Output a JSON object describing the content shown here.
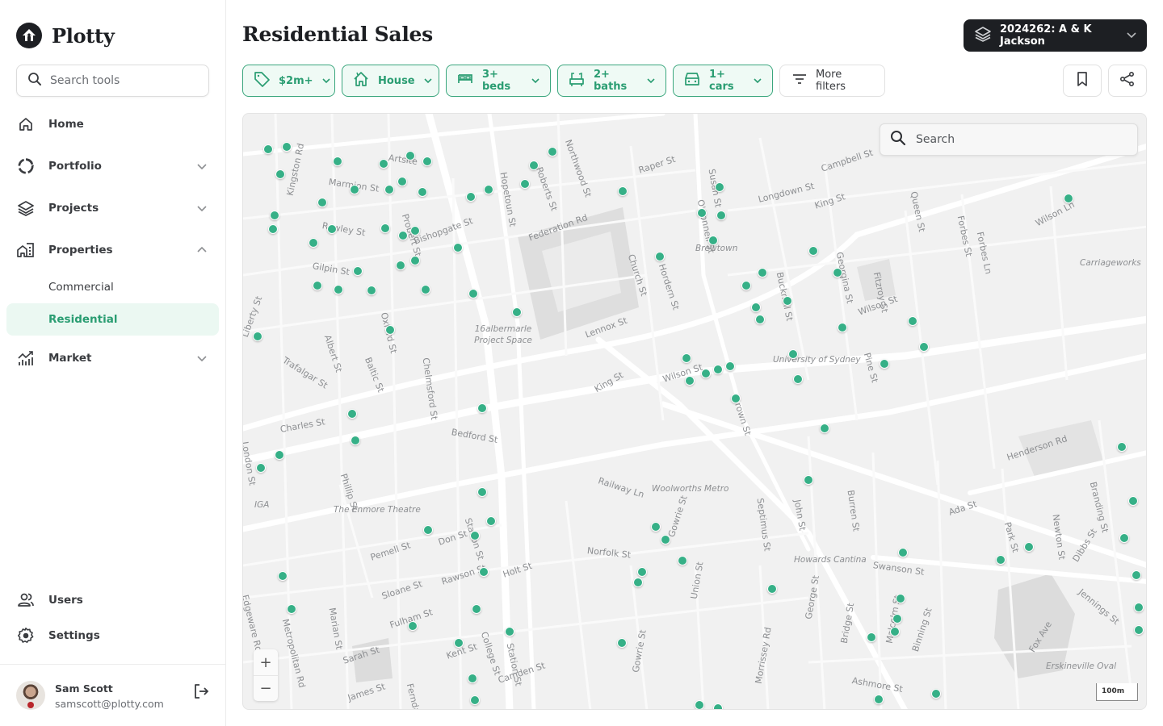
{
  "brand": {
    "name": "Plotty",
    "logo_icon": "home-up-arrow-icon"
  },
  "sidebar": {
    "search_placeholder": "Search tools",
    "items": [
      {
        "label": "Home",
        "icon": "home-icon",
        "has_chevron": false
      },
      {
        "label": "Portfolio",
        "icon": "portfolio-ring-icon",
        "has_chevron": true,
        "expanded": false
      },
      {
        "label": "Projects",
        "icon": "layers-icon",
        "has_chevron": true,
        "expanded": false
      },
      {
        "label": "Properties",
        "icon": "buildings-icon",
        "has_chevron": true,
        "expanded": true,
        "children": [
          {
            "label": "Commercial",
            "active": false
          },
          {
            "label": "Residential",
            "active": true
          }
        ]
      },
      {
        "label": "Market",
        "icon": "market-chart-icon",
        "has_chevron": true,
        "expanded": false
      }
    ],
    "bottom_items": [
      {
        "label": "Users",
        "icon": "users-icon"
      },
      {
        "label": "Settings",
        "icon": "gear-icon"
      }
    ],
    "user": {
      "name": "Sam Scott",
      "email": "samscott@plotty.com",
      "logout_icon": "logout-icon"
    }
  },
  "header": {
    "title": "Residential Sales",
    "project_selector": {
      "label": "2024262: A & K Jackson",
      "icon": "layers-icon"
    },
    "filters": [
      {
        "label": "$2m+",
        "icon": "price-tag-icon",
        "active": true
      },
      {
        "label": "House",
        "icon": "house-icon",
        "active": true
      },
      {
        "label": "3+ beds",
        "icon": "bed-icon",
        "active": true
      },
      {
        "label": "2+ baths",
        "icon": "bath-icon",
        "active": true
      },
      {
        "label": "1+ cars",
        "icon": "car-icon",
        "active": true
      },
      {
        "label": "More filters",
        "icon": "filter-lines-icon",
        "active": false
      }
    ],
    "actions": [
      {
        "name": "bookmark",
        "icon": "bookmark-icon"
      },
      {
        "name": "share",
        "icon": "share-icon"
      }
    ]
  },
  "colors": {
    "accent": "#36b087",
    "accent_text": "#2a9d72",
    "accent_bg": "#effaf5",
    "dark": "#1d1f23"
  },
  "map": {
    "search_placeholder": "Search",
    "scale_label": "100m",
    "zoom_in": "+",
    "zoom_out": "−",
    "street_labels": [
      "Kingston Rd",
      "Artsite",
      "Marmion St",
      "Probert St",
      "Roberts St",
      "Northwood St",
      "Hopetoun St",
      "Raper St",
      "Susan St",
      "O'Connell St",
      "Campbell St",
      "Longdown St",
      "King St",
      "Queen St",
      "Forbes St",
      "Forbes Ln",
      "Wilson Ln",
      "Rowley St",
      "Bishopgate St",
      "Federation Rd",
      "Church St",
      "Hordern St",
      "Bucknell St",
      "Georgina St",
      "Fitzroy St",
      "Gilpin St",
      "Oxford St",
      "Lennox St",
      "Wilson St",
      "Pine St",
      "Liberty St",
      "Albert St",
      "Baltic St",
      "Chelmsford St",
      "Trafalgar St",
      "King St",
      "Wilson St",
      "Brown St",
      "Charles St",
      "Bedford St",
      "Phillip St",
      "Henderson Rd",
      "Branding St",
      "Railway Ln",
      "Septimus St",
      "John St",
      "Burren St",
      "Station St",
      "Ada St",
      "Park St",
      "Newton St",
      "Don St",
      "Pemell St",
      "Gowrie St",
      "Norfolk St",
      "Dibbs St",
      "Swanson St",
      "Jennings St",
      "Rawson St",
      "Holt St",
      "Sloane St",
      "Union St",
      "George St",
      "Bridge St",
      "Malcolm St",
      "Fox Ave",
      "Edgeware Rd",
      "Metropolitan Rd",
      "Marian St",
      "Fulham St",
      "College St",
      "Station St",
      "Morrissey Rd",
      "Binning St",
      "Sarah St",
      "Kent St",
      "Gowrie St",
      "Ashmore St",
      "Camden St",
      "James St",
      "Ferndale St",
      "London St"
    ],
    "place_labels": [
      "Brewtown",
      "Carriageworks",
      "16albermarle Project Space",
      "University of Sydney",
      "IGA",
      "The Enmore Theatre",
      "Woolworths Metro",
      "Howards Cantina",
      "Erskineville Oval"
    ],
    "pin_count": 107
  }
}
